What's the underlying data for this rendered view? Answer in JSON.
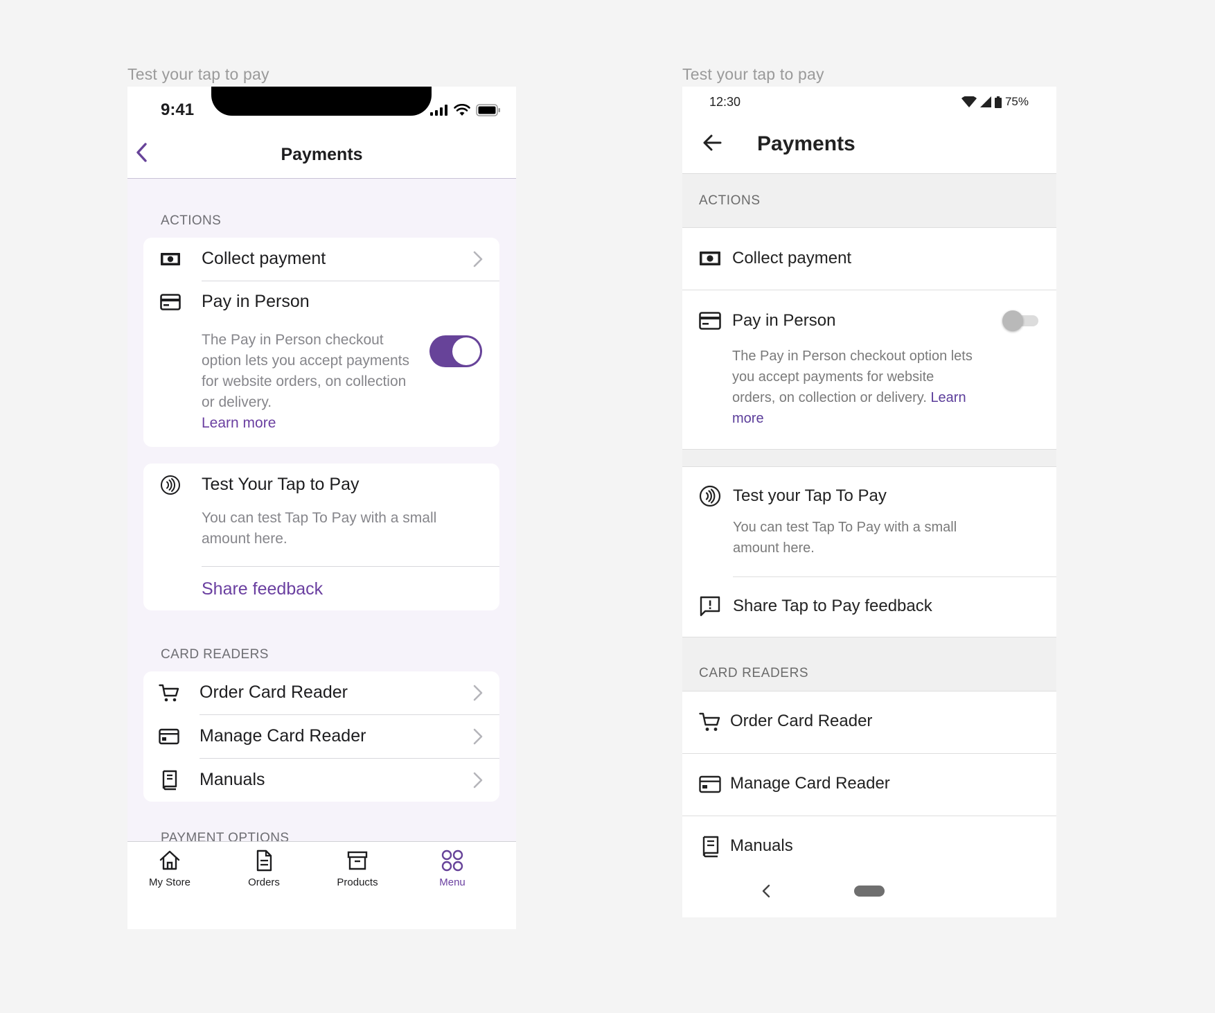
{
  "captions": {
    "left": "Test your tap to pay",
    "right": "Test your tap to pay"
  },
  "ios": {
    "status": {
      "time": "9:41"
    },
    "nav": {
      "title": "Payments"
    },
    "sections": {
      "actions": "ACTIONS",
      "card_readers": "CARD READERS",
      "payment_options": "PAYMENT OPTIONS"
    },
    "collect_payment": {
      "label": "Collect payment",
      "icon": "cash-icon"
    },
    "pay_in_person": {
      "label": "Pay in Person",
      "icon": "card-icon",
      "description": "The Pay in Person checkout option lets you accept payments for website orders, on collection or delivery.",
      "link": "Learn more",
      "enabled": true
    },
    "tap_to_pay": {
      "label": "Test Your Tap to Pay",
      "icon": "contactless-icon",
      "description": "You can test Tap To Pay with a small amount here.",
      "feedback": "Share feedback"
    },
    "card_readers": [
      {
        "label": "Order Card Reader",
        "icon": "cart-icon"
      },
      {
        "label": "Manage Card Reader",
        "icon": "card-reader-icon"
      },
      {
        "label": "Manuals",
        "icon": "book-icon"
      }
    ],
    "tabs": [
      {
        "label": "My Store",
        "icon": "home-icon",
        "active": false
      },
      {
        "label": "Orders",
        "icon": "document-icon",
        "active": false
      },
      {
        "label": "Products",
        "icon": "archive-icon",
        "active": false
      },
      {
        "label": "Menu",
        "icon": "grid-icon",
        "active": true
      }
    ]
  },
  "android": {
    "status": {
      "time": "12:30",
      "battery": "75%"
    },
    "nav": {
      "title": "Payments"
    },
    "sections": {
      "actions": "ACTIONS",
      "card_readers": "CARD READERS"
    },
    "collect_payment": {
      "label": "Collect payment",
      "icon": "cash-icon"
    },
    "pay_in_person": {
      "label": "Pay in Person",
      "icon": "card-icon",
      "description": "The Pay in Person checkout option lets you accept payments for website orders, on collection or delivery.",
      "link": "Learn more",
      "enabled": false
    },
    "tap_to_pay": {
      "label": "Test your Tap To Pay",
      "icon": "contactless-icon",
      "description": "You can test Tap To Pay with a small amount here."
    },
    "feedback": {
      "label": "Share Tap to Pay feedback",
      "icon": "feedback-icon"
    },
    "card_readers": [
      {
        "label": "Order Card Reader",
        "icon": "cart-icon"
      },
      {
        "label": "Manage Card Reader",
        "icon": "card-reader-icon"
      },
      {
        "label": "Manuals",
        "icon": "book-icon"
      }
    ]
  },
  "colors": {
    "accent": "#674399",
    "link": "#6a3fa0",
    "page_background": "#f4f4f4"
  }
}
